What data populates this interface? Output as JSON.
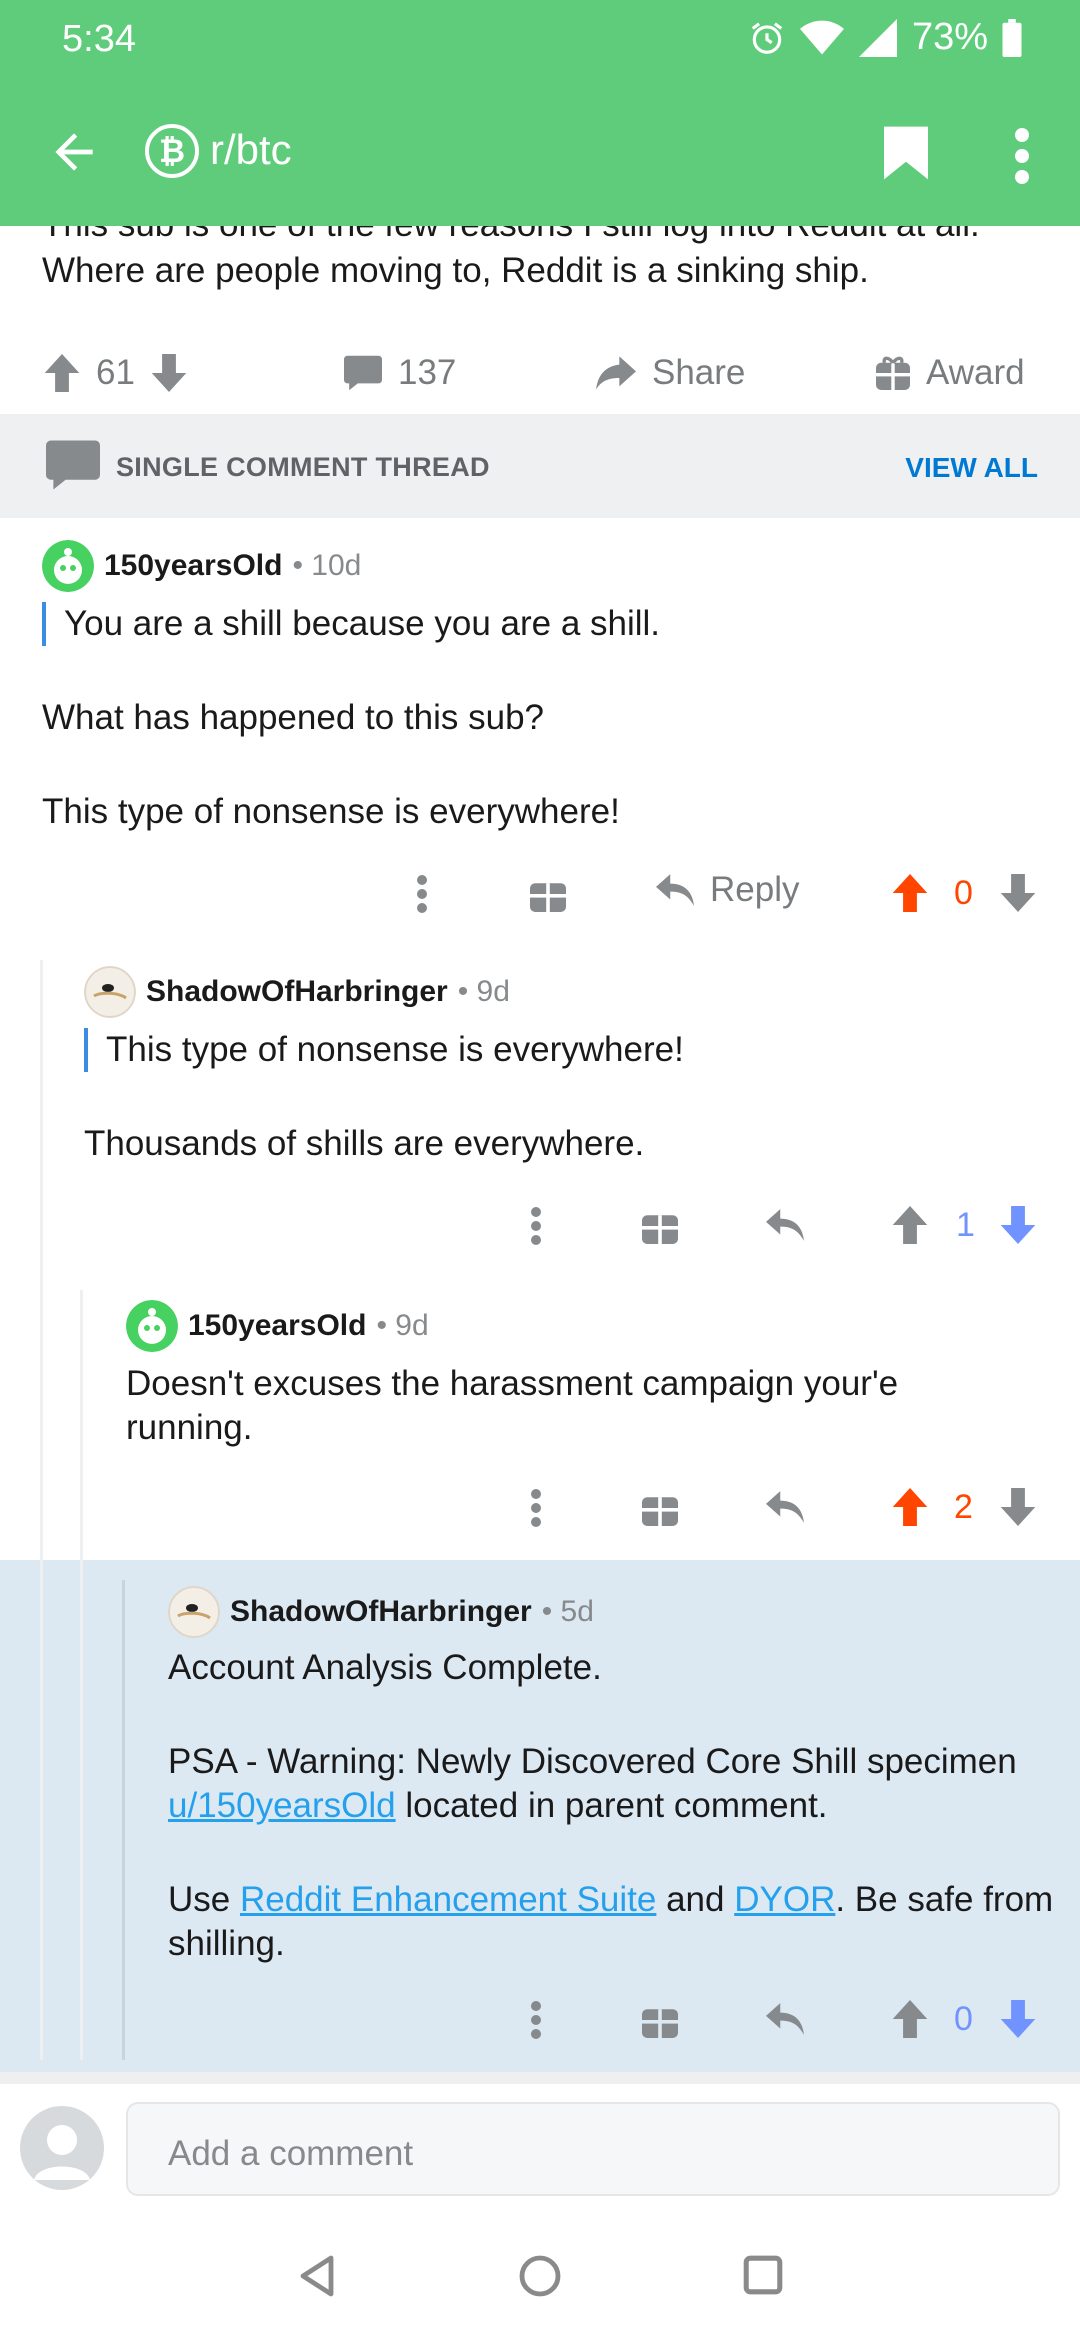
{
  "status": {
    "time": "5:34",
    "battery": "73%"
  },
  "header": {
    "subreddit": "r/btc",
    "sub_icon_glyph": "₿"
  },
  "post": {
    "clipped_line": "This sub is one of the few reasons I still log into Reddit at all.",
    "visible_line": "Where are people moving to, Reddit is a sinking ship.",
    "upvotes": "61",
    "comments": "137",
    "share_label": "Share",
    "award_label": "Award"
  },
  "thread_bar": {
    "label": "SINGLE COMMENT THREAD",
    "view_all": "VIEW ALL"
  },
  "comments": [
    {
      "author": "150yearsOld",
      "age": "• 10d",
      "quote": "You are a shill because you are a shill.",
      "paragraphs": [
        "What has happened to this sub?",
        "This type of nonsense is everywhere!"
      ],
      "reply_label": "Reply",
      "score": "0",
      "vote_state": "up"
    },
    {
      "author": "ShadowOfHarbringer",
      "age": "• 9d",
      "quote": "This type of nonsense is everywhere!",
      "paragraphs": [
        "Thousands of shills are everywhere."
      ],
      "score": "1",
      "vote_state": "down"
    },
    {
      "author": "150yearsOld",
      "age": "• 9d",
      "paragraphs": [
        "Doesn't excuses the harassment campaign your'e running."
      ],
      "score": "2",
      "vote_state": "up"
    },
    {
      "author": "ShadowOfHarbringer",
      "age": "• 5d",
      "p1": "Account Analysis Complete.",
      "p2_text": "PSA - Warning: Newly Discovered Core Shill specimen",
      "p2_link": "u/150yearsOld",
      "p2_tail": " located in parent comment.",
      "p3_a": "Use ",
      "p3_link1": "Reddit Enhancement Suite",
      "p3_b": " and ",
      "p3_link2": "DYOR",
      "p3_c": ". Be safe from shilling.",
      "score": "0",
      "vote_state": "down"
    }
  ],
  "composer": {
    "placeholder": "Add a comment"
  },
  "colors": {
    "app_bar": "#5ecc7a",
    "upvote": "#ff4500",
    "downvote": "#7193ff",
    "highlight": "#dce8f2",
    "link": "#24a0ed"
  }
}
